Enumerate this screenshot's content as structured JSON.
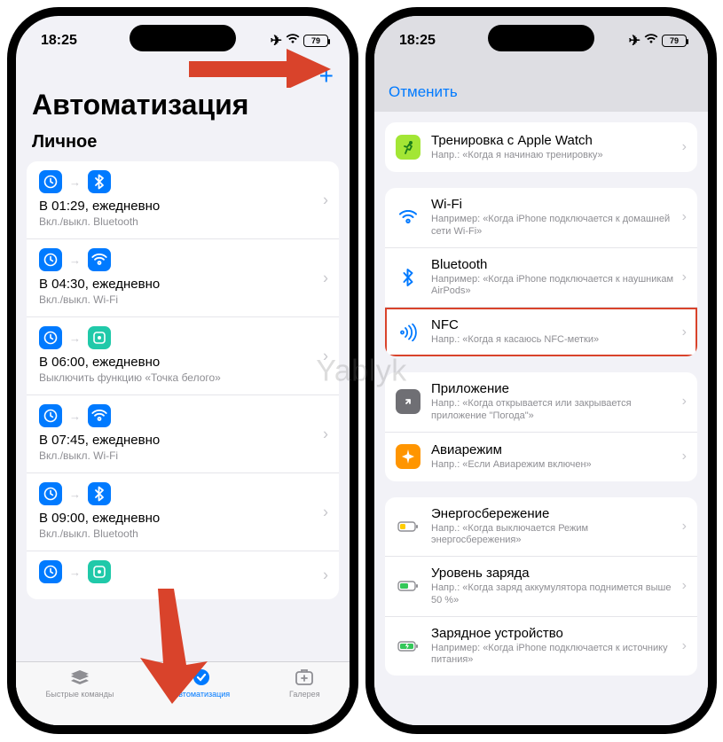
{
  "status": {
    "time": "18:25",
    "battery": "79"
  },
  "left": {
    "title": "Автоматизация",
    "section": "Личное",
    "plus": "+",
    "automations": [
      {
        "icon2": "bt",
        "title": "В 01:29, ежедневно",
        "sub": "Вкл./выкл. Bluetooth"
      },
      {
        "icon2": "wifi",
        "title": "В 04:30, ежедневно",
        "sub": "Вкл./выкл. Wi-Fi"
      },
      {
        "icon2": "teal",
        "title": "В 06:00, ежедневно",
        "sub": "Выключить функцию «Точка белого»"
      },
      {
        "icon2": "wifi",
        "title": "В 07:45, ежедневно",
        "sub": "Вкл./выкл. Wi-Fi"
      },
      {
        "icon2": "bt",
        "title": "В 09:00, ежедневно",
        "sub": "Вкл./выкл. Bluetooth"
      },
      {
        "icon2": "teal",
        "title": "",
        "sub": ""
      }
    ],
    "tabs": {
      "shortcuts": "Быстрые команды",
      "automation": "Автоматизация",
      "gallery": "Галерея"
    }
  },
  "right": {
    "cancel": "Отменить",
    "groups": [
      [
        {
          "icon": "workout",
          "title": "Тренировка с Apple Watch",
          "sub": "Напр.: «Когда я начинаю тренировку»"
        }
      ],
      [
        {
          "icon": "wifi2",
          "title": "Wi-Fi",
          "sub": "Например: «Когда iPhone подключается к домашней сети Wi-Fi»"
        },
        {
          "icon": "bt2",
          "title": "Bluetooth",
          "sub": "Например: «Когда iPhone подключается к наушникам AirPods»"
        },
        {
          "icon": "nfc",
          "title": "NFC",
          "sub": "Напр.: «Когда я касаюсь NFC-метки»",
          "highlighted": true
        }
      ],
      [
        {
          "icon": "app",
          "title": "Приложение",
          "sub": "Напр.: «Когда открывается или закрывается приложение \"Погода\"»"
        },
        {
          "icon": "airplane",
          "title": "Авиарежим",
          "sub": "Напр.: «Если Авиарежим включен»"
        }
      ],
      [
        {
          "icon": "lowpower",
          "title": "Энергосбережение",
          "sub": "Напр.: «Когда выключается Режим энергосбережения»"
        },
        {
          "icon": "battlevel",
          "title": "Уровень заряда",
          "sub": "Напр.: «Когда заряд аккумулятора поднимется выше 50 %»"
        },
        {
          "icon": "charger",
          "title": "Зарядное устройство",
          "sub": "Например: «Когда iPhone подключается к источнику питания»"
        }
      ]
    ]
  },
  "watermark": "Yablyk"
}
